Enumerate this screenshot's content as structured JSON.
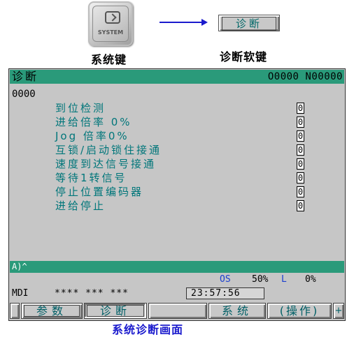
{
  "illustration": {
    "system_key_label": "SYSTEM",
    "system_key_caption": "系统键",
    "softkey_preview_label": "诊断",
    "softkey_caption": "诊断软键",
    "arrow_color": "#1a1acd"
  },
  "screen": {
    "title": "诊断",
    "program_info": "O0000 N00000",
    "param_number": "0000",
    "diag_items": [
      {
        "label": "到位检测",
        "value": "0"
      },
      {
        "label": "进给倍率 0%",
        "value": "0"
      },
      {
        "label": "Jog 倍率0%",
        "value": "0"
      },
      {
        "label": "互锁/启动锁住接通",
        "value": "0"
      },
      {
        "label": "速度到达信号接通",
        "value": "0"
      },
      {
        "label": "等待1转信号",
        "value": "0"
      },
      {
        "label": "停止位置编码器",
        "value": "0"
      },
      {
        "label": "进给停止",
        "value": "0"
      }
    ],
    "command_prompt": "A)^",
    "override": {
      "os_label": "OS",
      "os_value": "50%",
      "l_label": "L",
      "l_value": "0%"
    },
    "mode": "MDI",
    "status_stars": "**** *** ***",
    "clock": "23:57:56",
    "softkeys": [
      {
        "label": "参数",
        "selected": false
      },
      {
        "label": "诊断",
        "selected": true
      },
      {
        "label": "",
        "selected": false
      },
      {
        "label": "系统",
        "selected": false
      },
      {
        "label": "(操作)",
        "selected": false
      }
    ],
    "softkey_right_arrow": "+",
    "accent_color": "#2a9a7a",
    "label_color": "#00767a"
  },
  "bottom_caption": "系统诊断画面"
}
